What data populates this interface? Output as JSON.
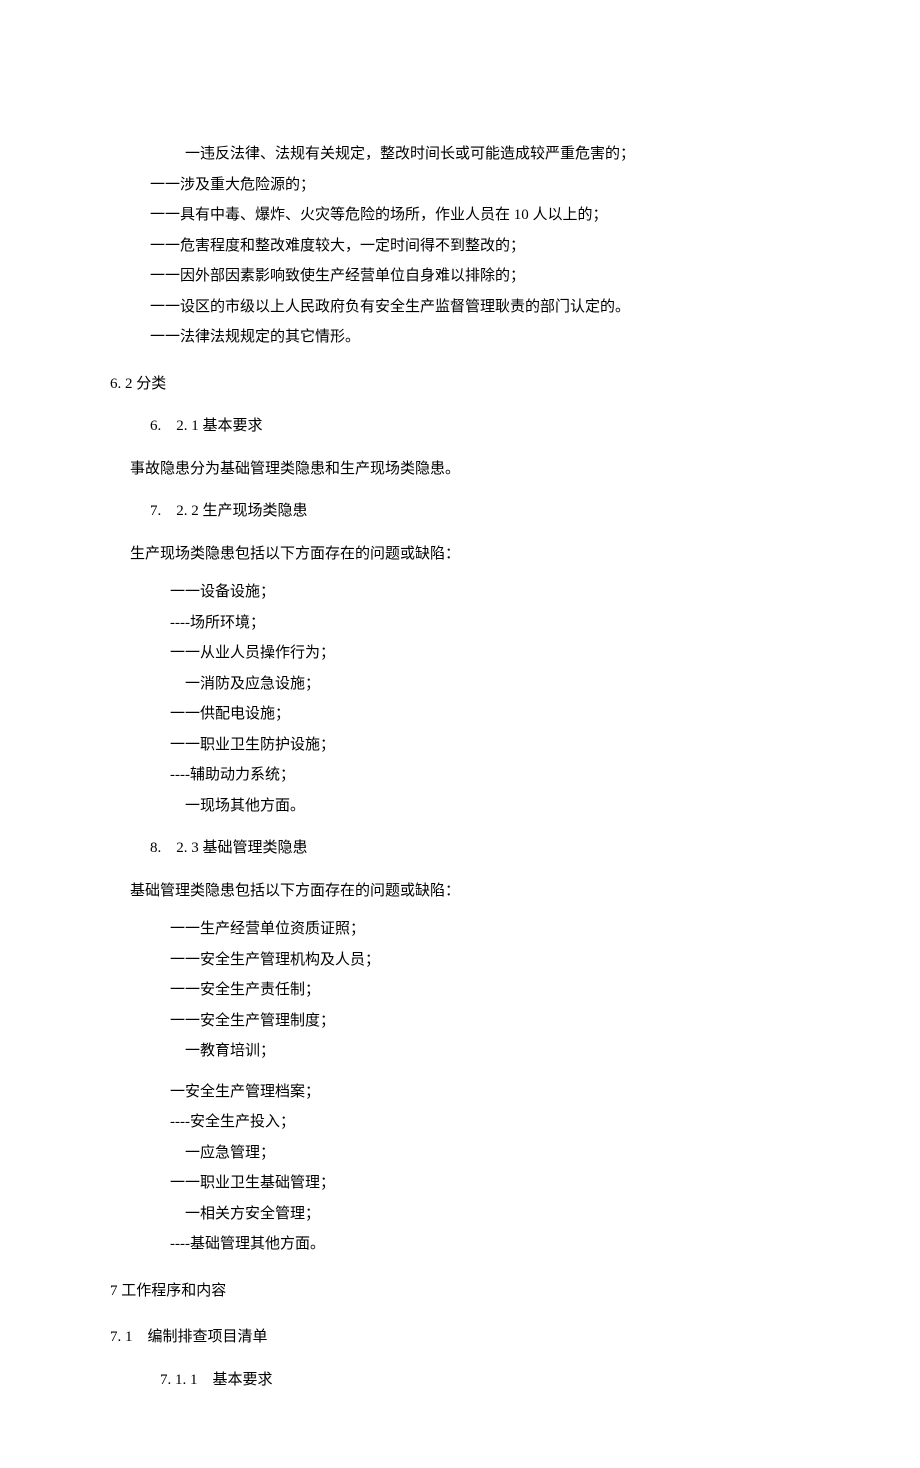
{
  "top_list": [
    "　一违反法律、法规有关规定，整改时间长或可能造成较严重危害的；",
    "一一涉及重大危险源的；",
    "一一具有中毒、爆炸、火灾等危险的场所，作业人员在 10 人以上的；",
    "一一危害程度和整改难度较大，一定时间得不到整改的；",
    "一一因外部因素影响致使生产经营单位自身难以排除的；",
    "一一设区的市级以上人民政府负有安全生产监督管理耿责的部门认定的。",
    "一一法律法规规定的其它情形。"
  ],
  "s6_2": {
    "title": "6. 2 分类",
    "s6_2_1": {
      "title": "6.　2. 1 基本要求",
      "body": "事故隐患分为基础管理类隐患和生产现场类隐患。"
    },
    "s6_2_2": {
      "title": "7.　2. 2 生产现场类隐患",
      "body": "生产现场类隐患包括以下方面存在的问题或缺陷：",
      "items": [
        "一一设备设施；",
        "----场所环境；",
        "一一从业人员操作行为；",
        "　一消防及应急设施；",
        "一一供配电设施；",
        "一一职业卫生防护设施；",
        "----辅助动力系统；",
        "　一现场其他方面。"
      ]
    },
    "s6_2_3": {
      "title": "8.　2. 3 基础管理类隐患",
      "body": "基础管理类隐患包括以下方面存在的问题或缺陷：",
      "items1": [
        "一一生产经营单位资质证照；",
        "一一安全生产管理机构及人员；",
        "一一安全生产责任制；",
        "一一安全生产管理制度；",
        "　一教育培训；"
      ],
      "items2": [
        "一安全生产管理档案；",
        "----安全生产投入；",
        "　一应急管理；",
        "一一职业卫生基础管理；",
        "　一相关方安全管理；",
        "----基础管理其他方面。"
      ]
    }
  },
  "s7": {
    "title": "7 工作程序和内容",
    "s7_1": {
      "title": "7. 1　编制排查项目清单",
      "s7_1_1": {
        "title": "7. 1. 1　基本要求"
      }
    }
  }
}
